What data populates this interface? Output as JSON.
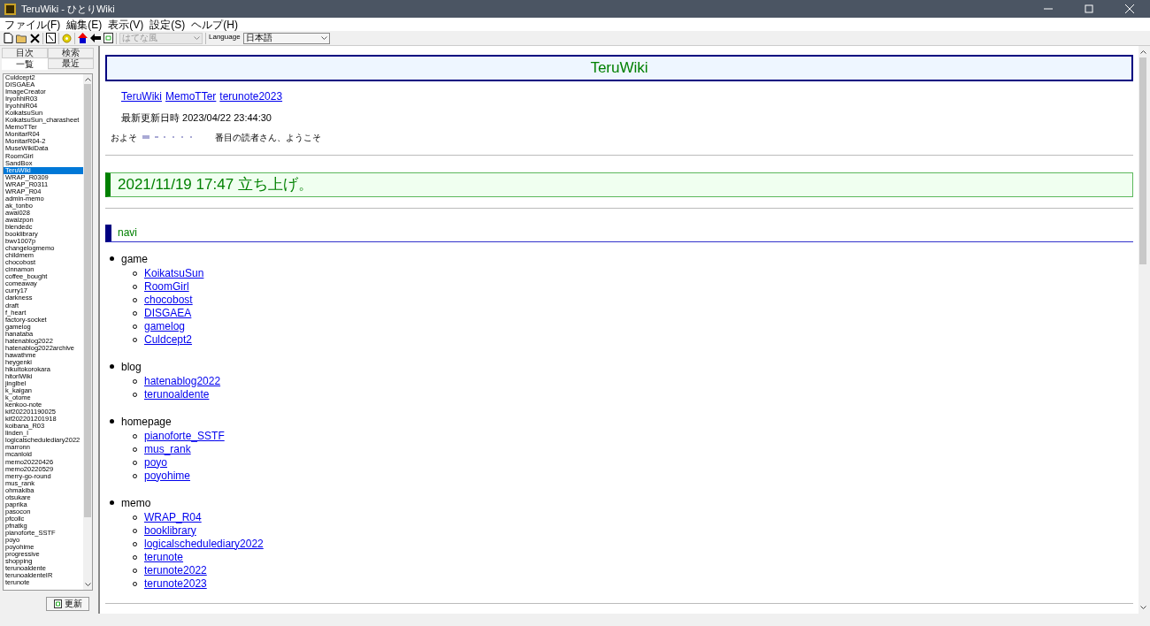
{
  "window": {
    "title": "TeruWiki - ひとりWiki"
  },
  "menu": [
    "ファイル(F)",
    "編集(E)",
    "表示(V)",
    "設定(S)",
    "ヘルプ(H)"
  ],
  "toolbar": {
    "style_select": {
      "value": "はてな風",
      "disabled": true
    },
    "language_label": "Language",
    "language_select": {
      "value": "日本語",
      "disabled": false
    }
  },
  "sidebar": {
    "tabs": [
      {
        "label": "目次",
        "selected": false
      },
      {
        "label": "検索",
        "selected": false
      },
      {
        "label": "一覧",
        "selected": true
      },
      {
        "label": "最近",
        "selected": false
      }
    ],
    "items": [
      {
        "label": "Culdcept2",
        "selected": false
      },
      {
        "label": "DISGAEA",
        "selected": false
      },
      {
        "label": "ImageCreator",
        "selected": false
      },
      {
        "label": "IryohhiR03",
        "selected": false
      },
      {
        "label": "IryohhiR04",
        "selected": false
      },
      {
        "label": "KoikatsuSun",
        "selected": false
      },
      {
        "label": "KoikatsuSun_charasheet",
        "selected": false
      },
      {
        "label": "MemoTTer",
        "selected": false
      },
      {
        "label": "MonitarR04",
        "selected": false
      },
      {
        "label": "MonitarR04-2",
        "selected": false
      },
      {
        "label": "MuseWikiData",
        "selected": false
      },
      {
        "label": "RoomGirl",
        "selected": false
      },
      {
        "label": "SandBox",
        "selected": false
      },
      {
        "label": "TeruWiki",
        "selected": true
      },
      {
        "label": "WRAP_R0309",
        "selected": false
      },
      {
        "label": "WRAP_R0311",
        "selected": false
      },
      {
        "label": "WRAP_R04",
        "selected": false
      },
      {
        "label": "admin-memo",
        "selected": false
      },
      {
        "label": "ak_tonbo",
        "selected": false
      },
      {
        "label": "awai028",
        "selected": false
      },
      {
        "label": "awaizpon",
        "selected": false
      },
      {
        "label": "blendedc",
        "selected": false
      },
      {
        "label": "booklibrary",
        "selected": false
      },
      {
        "label": "bwv1007p",
        "selected": false
      },
      {
        "label": "changelogmemo",
        "selected": false
      },
      {
        "label": "childmem",
        "selected": false
      },
      {
        "label": "chocobost",
        "selected": false
      },
      {
        "label": "cinnamon",
        "selected": false
      },
      {
        "label": "coffee_bought",
        "selected": false
      },
      {
        "label": "comeaway",
        "selected": false
      },
      {
        "label": "curry17",
        "selected": false
      },
      {
        "label": "darkness",
        "selected": false
      },
      {
        "label": "draft",
        "selected": false
      },
      {
        "label": "f_heart",
        "selected": false
      },
      {
        "label": "factory-socket",
        "selected": false
      },
      {
        "label": "gamelog",
        "selected": false
      },
      {
        "label": "hanataba",
        "selected": false
      },
      {
        "label": "hatenablog2022",
        "selected": false
      },
      {
        "label": "hatenablog2022archive",
        "selected": false
      },
      {
        "label": "hawathme",
        "selected": false
      },
      {
        "label": "heygenki",
        "selected": false
      },
      {
        "label": "hikuitokorokara",
        "selected": false
      },
      {
        "label": "hitoriWiki",
        "selected": false
      },
      {
        "label": "jinglbel",
        "selected": false
      },
      {
        "label": "k_kaigan",
        "selected": false
      },
      {
        "label": "k_otome",
        "selected": false
      },
      {
        "label": "kenkoo-note",
        "selected": false
      },
      {
        "label": "kif202201190025",
        "selected": false
      },
      {
        "label": "kif202201201918",
        "selected": false
      },
      {
        "label": "koibana_R03",
        "selected": false
      },
      {
        "label": "linden_l",
        "selected": false
      },
      {
        "label": "logicalschedulediary2022",
        "selected": false
      },
      {
        "label": "marronn",
        "selected": false
      },
      {
        "label": "mcanloid",
        "selected": false
      },
      {
        "label": "memo20220426",
        "selected": false
      },
      {
        "label": "memo20220529",
        "selected": false
      },
      {
        "label": "merry-go-round",
        "selected": false
      },
      {
        "label": "mus_rank",
        "selected": false
      },
      {
        "label": "ohmakiba",
        "selected": false
      },
      {
        "label": "otsukare",
        "selected": false
      },
      {
        "label": "paprika",
        "selected": false
      },
      {
        "label": "pasocon",
        "selected": false
      },
      {
        "label": "pfcollc",
        "selected": false
      },
      {
        "label": "pfnatkg",
        "selected": false
      },
      {
        "label": "pianoforte_SSTF",
        "selected": false
      },
      {
        "label": "poyo",
        "selected": false
      },
      {
        "label": "poyohime",
        "selected": false
      },
      {
        "label": "progressive",
        "selected": false
      },
      {
        "label": "shopping",
        "selected": false
      },
      {
        "label": "terunoaldente",
        "selected": false
      },
      {
        "label": "terunoaldenteIR",
        "selected": false
      },
      {
        "label": "terunote",
        "selected": false
      }
    ],
    "refresh_button": "更新"
  },
  "page": {
    "title": "TeruWiki",
    "links": [
      "TeruWiki",
      "MemoTTer",
      "terunote2023"
    ],
    "updated": "最新更新日時 2023/04/22 23:44:30",
    "counter": {
      "prefix": "およそ",
      "suffix": "番目の読者さん、ようこそ"
    },
    "entry_heading": "2021/11/19 17:47 立ち上げ。",
    "section": {
      "heading": "navi",
      "groups": [
        {
          "label": "game",
          "links": [
            "KoikatsuSun",
            "RoomGirl",
            "chocobost",
            "DISGAEA",
            "gamelog",
            "Culdcept2"
          ]
        },
        {
          "label": "blog",
          "links": [
            "hatenablog2022",
            "terunoaldente"
          ]
        },
        {
          "label": "homepage",
          "links": [
            "pianoforte_SSTF",
            "mus_rank",
            "poyo",
            "poyohime"
          ]
        },
        {
          "label": "memo",
          "links": [
            "WRAP_R04",
            "booklibrary",
            "logicalschedulediary2022",
            "terunote",
            "terunote2022",
            "terunote2023"
          ]
        }
      ]
    }
  }
}
